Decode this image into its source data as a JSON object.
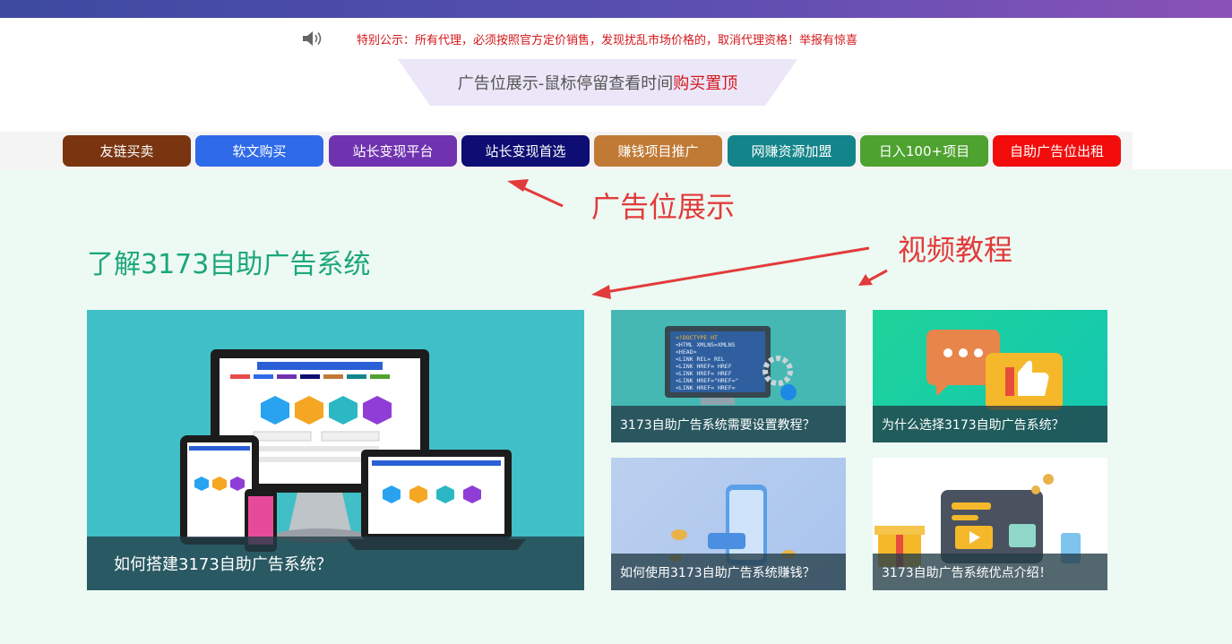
{
  "notice": {
    "icon": "speaker-icon",
    "text": "特别公示：所有代理，必须按照官方定价销售，发现扰乱市场价格的，取消代理资格！举报有惊喜"
  },
  "ad_tab": {
    "text_prefix": "广告位展示-鼠标停留查看时间",
    "text_highlight": "购买置顶"
  },
  "nav": [
    {
      "label": "友链买卖",
      "color": "#7a3510"
    },
    {
      "label": "软文购买",
      "color": "#2f6be8"
    },
    {
      "label": "站长变现平台",
      "color": "#6f33b0"
    },
    {
      "label": "站长变现首选",
      "color": "#0d0d73"
    },
    {
      "label": "赚钱项目推广",
      "color": "#c07a35"
    },
    {
      "label": "网赚资源加盟",
      "color": "#13858a"
    },
    {
      "label": "日入100+项目",
      "color": "#4ea22f"
    },
    {
      "label": "自助广告位出租",
      "color": "#f20c0c"
    }
  ],
  "annotations": {
    "ad_display": "广告位展示",
    "video_tutorial": "视频教程"
  },
  "section": {
    "title": "了解3173自助广告系统"
  },
  "cards": [
    {
      "caption": "如何搭建3173自助广告系统？"
    },
    {
      "caption": "3173自助广告系统需要设置教程？"
    },
    {
      "caption": "为什么选择3173自助广告系统？"
    },
    {
      "caption": "如何使用3173自助广告系统赚钱？"
    },
    {
      "caption": "3173自助广告系统优点介绍！"
    }
  ],
  "code_lines": [
    "<!DOCTYPE HT",
    "<HTML XMLNS=XMLNS",
    "<HEAD>",
    "<LINK REL= REL",
    "<LINK HREF= HREF",
    "<LINK HREF= HREF",
    "<LINK HREF=\"HREF=\"",
    "<LINK HREF= HREF="
  ]
}
